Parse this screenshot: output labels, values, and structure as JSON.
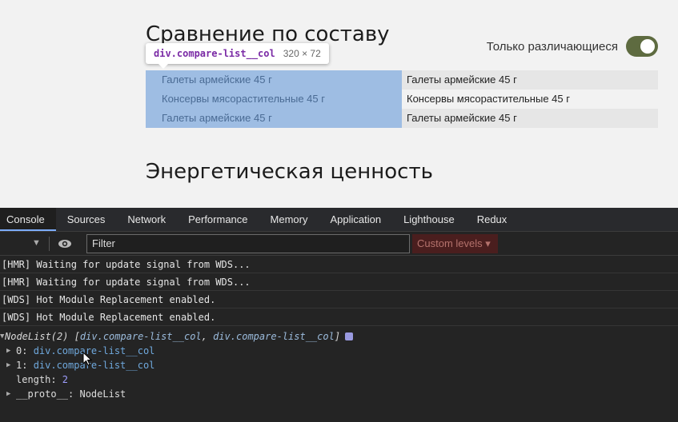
{
  "page": {
    "section1_title": "Сравнение по составу",
    "section2_title": "Энергетическая ценность",
    "toggle_label": "Только различающиеся",
    "toggle_on": true,
    "compare_rows": [
      {
        "left": "Галеты армейские 45 г",
        "right": "Галеты армейские 45 г"
      },
      {
        "left": "Консервы мясорастительные 45 г",
        "right": "Консервы мясорастительные 45 г"
      },
      {
        "left": "Галеты армейские 45 г",
        "right": "Галеты армейские 45 г"
      }
    ],
    "highlight_tooltip": {
      "selector": "div.compare-list__col",
      "size": "320 × 72"
    }
  },
  "colors": {
    "toggle_green": "#5e6b40",
    "highlight_blue": "#9ebde3",
    "devtools_bg": "#242424"
  },
  "devtools": {
    "tabs": [
      "Console",
      "Sources",
      "Network",
      "Performance",
      "Memory",
      "Application",
      "Lighthouse",
      "Redux"
    ],
    "active_tab": "Console",
    "filter_placeholder": "Filter",
    "levels_label": "Custom levels ▾",
    "messages": [
      "[HMR] Waiting for update signal from WDS...",
      "[HMR] Waiting for update signal from WDS...",
      "[WDS] Hot Module Replacement enabled.",
      "[WDS] Hot Module Replacement enabled."
    ],
    "nodelist": {
      "head_prefix": "NodeList(2) [",
      "head_item1": "div.compare-list__col",
      "head_sep": ", ",
      "head_item2": "div.compare-list__col",
      "head_suffix": "]",
      "item0_key": "0: ",
      "item0_val": "div.compare-list__col",
      "item1_key": "1: ",
      "item1_val": "div.compare-list__col",
      "length_key": "length: ",
      "length_val": "2",
      "proto_key": "__proto__: ",
      "proto_val": "NodeList"
    }
  }
}
